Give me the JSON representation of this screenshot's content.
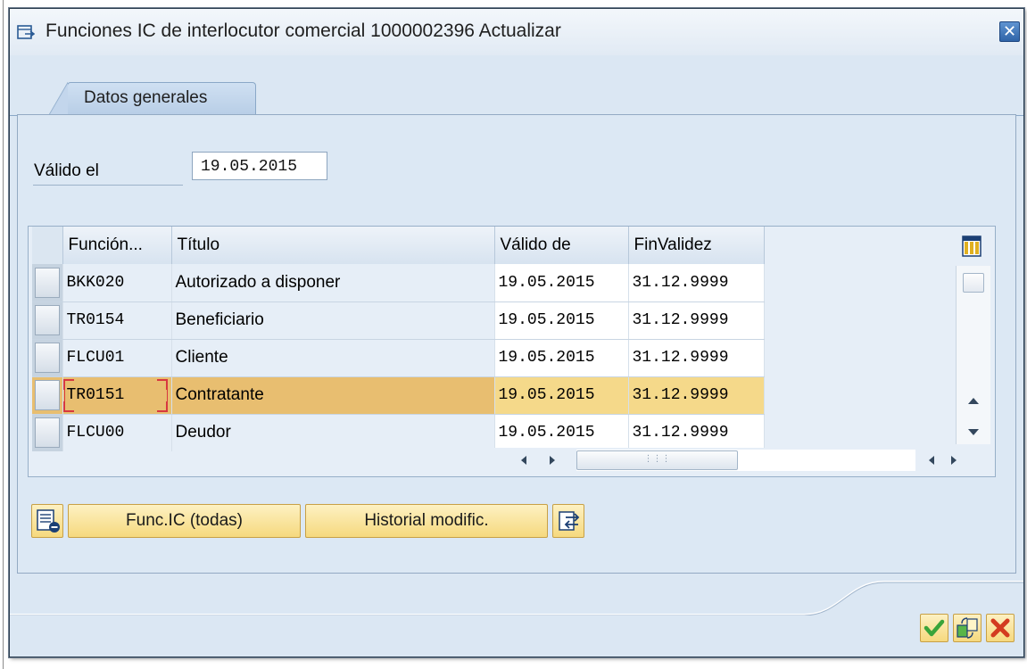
{
  "window": {
    "title": "Funciones IC de interlocutor comercial 1000002396 Actualizar",
    "close_icon": "close-icon"
  },
  "tabs": [
    {
      "label": "Datos generales",
      "active": true
    }
  ],
  "valid_on": {
    "label": "Válido el",
    "value": "19.05.2015"
  },
  "table": {
    "columns": [
      "Función...",
      "Título",
      "Válido de",
      "FinValidez"
    ],
    "rows": [
      {
        "funcion": "BKK020",
        "titulo": "Autorizado a disponer",
        "valido_de": "19.05.2015",
        "fin_validez": "31.12.9999"
      },
      {
        "funcion": "TR0154",
        "titulo": "Beneficiario",
        "valido_de": "19.05.2015",
        "fin_validez": "31.12.9999"
      },
      {
        "funcion": "FLCU01",
        "titulo": "Cliente",
        "valido_de": "19.05.2015",
        "fin_validez": "31.12.9999"
      },
      {
        "funcion": "TR0151",
        "titulo": "Contratante",
        "valido_de": "19.05.2015",
        "fin_validez": "31.12.9999",
        "highlighted": true
      },
      {
        "funcion": "FLCU00",
        "titulo": "Deudor",
        "valido_de": "19.05.2015",
        "fin_validez": "31.12.9999"
      }
    ],
    "highlight_color": "#e8be70"
  },
  "buttons": {
    "func_ic": "Func.IC (todas)",
    "historial": "Historial modific."
  },
  "colors": {
    "dialog_bg": "#dbe7f3",
    "button_yellow": "#f6d97e",
    "close_blue": "#2f64a8",
    "ok_green": "#3aa43a",
    "cancel_red": "#d33b1f"
  },
  "icons": [
    "dialog-icon",
    "close-icon",
    "column-settings-icon",
    "delete-row-icon",
    "export-icon",
    "ok-check-icon",
    "copy-icon",
    "cancel-x-icon"
  ]
}
